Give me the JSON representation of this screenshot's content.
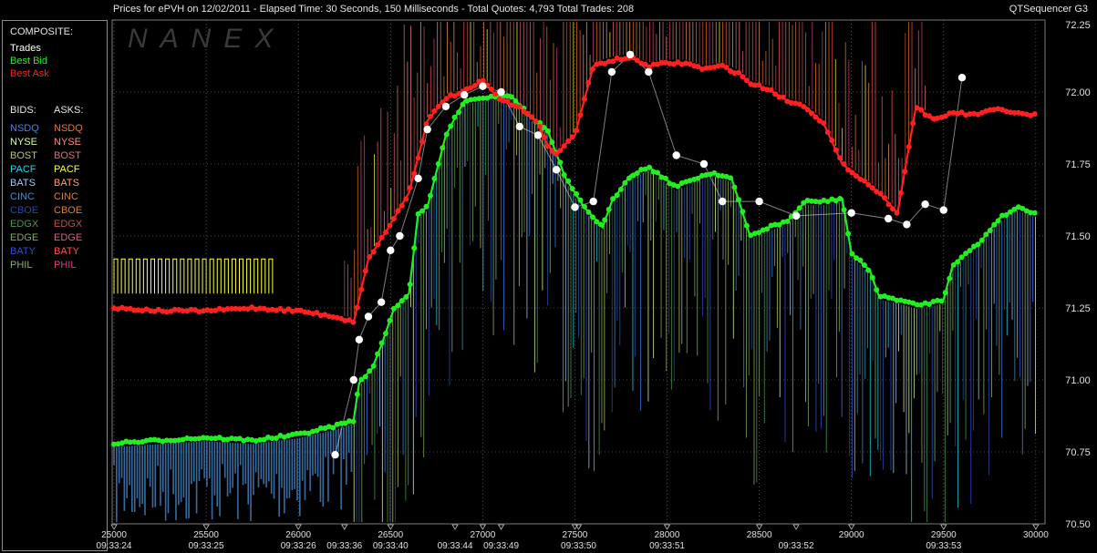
{
  "header": {
    "title": "Prices for  ePVH  on  12/02/2011  -  Elapsed Time: 30 Seconds, 150 Milliseconds  -  Total Quotes: 4,793  Total Trades: 208",
    "app": "QTSequencer G3",
    "watermark": "NANEX"
  },
  "legend": {
    "composite_label": "COMPOSITE:",
    "composite": [
      {
        "label": "Trades",
        "color": "#ffffff"
      },
      {
        "label": "Best Bid",
        "color": "#22ee22"
      },
      {
        "label": "Best Ask",
        "color": "#ff2020"
      }
    ],
    "bids_label": "BIDS:",
    "asks_label": "ASKS:",
    "exchanges": [
      {
        "bid": "NSDQ",
        "ask": "NSDQ",
        "bid_color": "#3b82f6",
        "ask_color": "#f97316"
      },
      {
        "bid": "NYSE",
        "ask": "NYSE",
        "bid_color": "#d8ffa0",
        "ask_color": "#ff8a80"
      },
      {
        "bid": "BOST",
        "ask": "BOST",
        "bid_color": "#b8c870",
        "ask_color": "#e07070"
      },
      {
        "bid": "PACF",
        "ask": "PACF",
        "bid_color": "#22d3ee",
        "ask_color": "#ffff40"
      },
      {
        "bid": "BATS",
        "ask": "BATS",
        "bid_color": "#a0c8ff",
        "ask_color": "#ffa060"
      },
      {
        "bid": "CINC",
        "ask": "CINC",
        "bid_color": "#4090c0",
        "ask_color": "#d08040"
      },
      {
        "bid": "CBOE",
        "ask": "CBOE",
        "bid_color": "#2050a0",
        "ask_color": "#e08030"
      },
      {
        "bid": "EDGX",
        "ask": "EDGX",
        "bid_color": "#4a9a4a",
        "ask_color": "#c05050"
      },
      {
        "bid": "EDGE",
        "ask": "EDGE",
        "bid_color": "#80b060",
        "ask_color": "#e06080"
      },
      {
        "bid": "BATY",
        "ask": "BATY",
        "bid_color": "#3050d0",
        "ask_color": "#ff5050"
      },
      {
        "bid": "PHIL",
        "ask": "PHIL",
        "bid_color": "#90b070",
        "ask_color": "#e04080"
      }
    ]
  },
  "chart_data": {
    "type": "line",
    "xlim": [
      24990,
      30050
    ],
    "ylim": [
      70.5,
      72.25
    ],
    "y_ticks": [
      "72.25",
      "72.00",
      "71.75",
      "71.50",
      "71.25",
      "71.00",
      "70.75",
      "70.50"
    ],
    "x_ticks": [
      {
        "value": 25000,
        "label": "25000",
        "time": "09:33:24"
      },
      {
        "value": 25500,
        "label": "25500",
        "time": "09:33:25"
      },
      {
        "value": 26000,
        "label": "26000",
        "time": "09:33:26"
      },
      {
        "value": 26250,
        "label": "",
        "time": "09:33:36"
      },
      {
        "value": 26500,
        "label": "26500",
        "time": "09:33:40"
      },
      {
        "value": 26850,
        "label": "",
        "time": "09:33:44"
      },
      {
        "value": 27000,
        "label": "27000",
        "time": ""
      },
      {
        "value": 27100,
        "label": "",
        "time": "09:33:49"
      },
      {
        "value": 27500,
        "label": "27500",
        "time": ""
      },
      {
        "value": 27520,
        "label": "",
        "time": "09:33:50"
      },
      {
        "value": 28000,
        "label": "28000",
        "time": "09:33:51"
      },
      {
        "value": 28500,
        "label": "28500",
        "time": ""
      },
      {
        "value": 28700,
        "label": "",
        "time": "09:33:52"
      },
      {
        "value": 29000,
        "label": "29000",
        "time": ""
      },
      {
        "value": 29500,
        "label": "29500",
        "time": "09:33:53"
      },
      {
        "value": 30000,
        "label": "30000",
        "time": ""
      }
    ],
    "series": [
      {
        "name": "Best Bid",
        "color": "#22ee22",
        "points": [
          [
            25000,
            70.78
          ],
          [
            25250,
            70.79
          ],
          [
            25500,
            70.8
          ],
          [
            25750,
            70.79
          ],
          [
            26000,
            70.81
          ],
          [
            26200,
            70.84
          ],
          [
            26300,
            70.86
          ],
          [
            26330,
            70.99
          ],
          [
            26400,
            71.04
          ],
          [
            26450,
            71.12
          ],
          [
            26520,
            71.25
          ],
          [
            26600,
            71.3
          ],
          [
            26650,
            71.58
          ],
          [
            26700,
            71.6
          ],
          [
            26800,
            71.85
          ],
          [
            26900,
            71.97
          ],
          [
            27000,
            71.98
          ],
          [
            27150,
            71.99
          ],
          [
            27250,
            71.92
          ],
          [
            27350,
            71.87
          ],
          [
            27450,
            71.7
          ],
          [
            27550,
            71.6
          ],
          [
            27650,
            71.53
          ],
          [
            27700,
            71.62
          ],
          [
            27800,
            71.71
          ],
          [
            27900,
            71.74
          ],
          [
            28050,
            71.67
          ],
          [
            28150,
            71.7
          ],
          [
            28250,
            71.72
          ],
          [
            28350,
            71.7
          ],
          [
            28450,
            71.5
          ],
          [
            28550,
            71.53
          ],
          [
            28650,
            71.55
          ],
          [
            28750,
            71.62
          ],
          [
            28850,
            71.62
          ],
          [
            28950,
            71.63
          ],
          [
            29000,
            71.44
          ],
          [
            29100,
            71.38
          ],
          [
            29150,
            71.29
          ],
          [
            29250,
            71.28
          ],
          [
            29350,
            71.26
          ],
          [
            29450,
            71.27
          ],
          [
            29500,
            71.28
          ],
          [
            29550,
            71.4
          ],
          [
            29700,
            71.48
          ],
          [
            29800,
            71.56
          ],
          [
            29900,
            71.6
          ],
          [
            30000,
            71.58
          ]
        ]
      },
      {
        "name": "Best Ask",
        "color": "#ff2020",
        "points": [
          [
            25000,
            71.25
          ],
          [
            25250,
            71.24
          ],
          [
            25500,
            71.24
          ],
          [
            25750,
            71.25
          ],
          [
            26000,
            71.24
          ],
          [
            26200,
            71.22
          ],
          [
            26300,
            71.2
          ],
          [
            26380,
            71.42
          ],
          [
            26480,
            71.52
          ],
          [
            26600,
            71.65
          ],
          [
            26700,
            71.9
          ],
          [
            26800,
            71.98
          ],
          [
            26900,
            72.0
          ],
          [
            27000,
            72.04
          ],
          [
            27100,
            71.97
          ],
          [
            27200,
            71.95
          ],
          [
            27300,
            71.89
          ],
          [
            27350,
            71.82
          ],
          [
            27400,
            71.78
          ],
          [
            27450,
            71.82
          ],
          [
            27500,
            71.85
          ],
          [
            27600,
            72.09
          ],
          [
            27700,
            72.11
          ],
          [
            27800,
            72.12
          ],
          [
            27900,
            72.09
          ],
          [
            28000,
            72.1
          ],
          [
            28100,
            72.1
          ],
          [
            28200,
            72.08
          ],
          [
            28300,
            72.09
          ],
          [
            28400,
            72.06
          ],
          [
            28450,
            72.03
          ],
          [
            28550,
            72.01
          ],
          [
            28650,
            71.97
          ],
          [
            28750,
            71.95
          ],
          [
            28850,
            71.89
          ],
          [
            28950,
            71.75
          ],
          [
            29050,
            71.7
          ],
          [
            29150,
            71.65
          ],
          [
            29250,
            71.58
          ],
          [
            29350,
            71.95
          ],
          [
            29450,
            71.9
          ],
          [
            29550,
            71.93
          ],
          [
            29650,
            71.92
          ],
          [
            29800,
            71.94
          ],
          [
            29950,
            71.92
          ],
          [
            30000,
            71.92
          ]
        ]
      },
      {
        "name": "Trades",
        "color": "#ffffff",
        "points": [
          [
            26200,
            70.74
          ],
          [
            26300,
            71.0
          ],
          [
            26330,
            71.14
          ],
          [
            26380,
            71.22
          ],
          [
            26450,
            71.27
          ],
          [
            26500,
            71.45
          ],
          [
            26550,
            71.5
          ],
          [
            26650,
            71.7
          ],
          [
            26700,
            71.87
          ],
          [
            26800,
            71.95
          ],
          [
            26900,
            71.99
          ],
          [
            27000,
            72.02
          ],
          [
            27100,
            72.0
          ],
          [
            27200,
            71.88
          ],
          [
            27300,
            71.85
          ],
          [
            27400,
            71.73
          ],
          [
            27500,
            71.6
          ],
          [
            27600,
            71.62
          ],
          [
            27700,
            72.07
          ],
          [
            27800,
            72.13
          ],
          [
            27900,
            72.07
          ],
          [
            28050,
            71.78
          ],
          [
            28200,
            71.75
          ],
          [
            28300,
            71.62
          ],
          [
            28500,
            71.62
          ],
          [
            28700,
            71.57
          ],
          [
            29000,
            71.58
          ],
          [
            29200,
            71.56
          ],
          [
            29300,
            71.54
          ],
          [
            29400,
            71.61
          ],
          [
            29500,
            71.59
          ],
          [
            29600,
            72.05
          ]
        ]
      }
    ]
  }
}
